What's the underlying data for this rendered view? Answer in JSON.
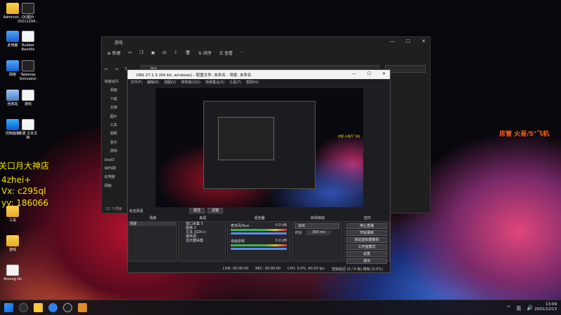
{
  "desktop": {
    "icons": [
      {
        "label": "Administ...",
        "kind": "folder"
      },
      {
        "label": "QQ图片\n20211204...",
        "kind": "dark"
      },
      {
        "label": "此电脑",
        "kind": "pc"
      },
      {
        "label": "Rubber\nBandits",
        "kind": "doc"
      },
      {
        "label": "网络",
        "kind": "pc"
      },
      {
        "label": "Tabletop\nSimulator",
        "kind": "dark"
      },
      {
        "label": "回收站",
        "kind": "bin"
      },
      {
        "label": "游戏",
        "kind": "doc"
      },
      {
        "label": "控制面板",
        "kind": "app"
      },
      {
        "label": "新建 文本文\n档",
        "kind": "doc"
      },
      {
        "label": "工具",
        "kind": "folder"
      },
      {
        "label": "游戏",
        "kind": "folder"
      },
      {
        "label": "Among Us",
        "kind": "doc"
      }
    ]
  },
  "overlay": {
    "line1": "关口月大神店",
    "line2": "4zhei+",
    "line3": "Vx: c295ql",
    "line4": "yy: 186066"
  },
  "right_overlay": "房管 火哥/5°飞机",
  "preview_text": "房管 火哥/5°飞机",
  "explorer": {
    "title": "游戏",
    "new_label": "新建",
    "sort_label": "排序",
    "view_label": "查看",
    "more_label": "···",
    "address": "游戏",
    "nav": [
      "快速访问",
      "桌面",
      "下载",
      "文档",
      "图片",
      "工具",
      "视频",
      "音乐",
      "游戏",
      "OneD",
      "WPS网",
      "此电脑",
      "网络"
    ],
    "status": "17 个项目"
  },
  "obs": {
    "title": "OBS 27.1.3 (64-bit, windows) - 配置文件: 未命名 - 场景: 未命名",
    "menu": [
      "文件(F)",
      "编辑(E)",
      "视图(V)",
      "停靠窗口(D)",
      "场景集合(S)",
      "工具(T)",
      "帮助(H)"
    ],
    "no_source": "未选择源",
    "props_label": "属性",
    "filter_label": "滤镜",
    "panels": {
      "scenes": "场景",
      "sources": "来源",
      "mixer": "混音器",
      "transitions": "转场特效",
      "controls": "控件"
    },
    "scene_list": [
      "场景"
    ],
    "source_list": [
      "窗口采集 5",
      "图像 2",
      "文本 (GDI+)",
      "媒体源",
      "显示器采集"
    ],
    "mixer_tracks": [
      {
        "name": "麦克风/Aux",
        "level": "0.0 dB"
      },
      {
        "name": "桌面音频",
        "level": "0.0 dB"
      }
    ],
    "transition": {
      "type": "淡出",
      "duration_label": "时长",
      "duration": "300 ms"
    },
    "controls": [
      "停止直播",
      "开始录制",
      "启动虚拟摄像机",
      "工作室模式",
      "设置",
      "退出"
    ],
    "statusbar": {
      "live": "LIVE: 00:00:00",
      "rec": "REC: 00:00:00",
      "cpu": "CPU: 0.0%, 60.00 fps",
      "frames": "渲染延迟 (0 / 0 帧) 跳帧 (0.0%)"
    }
  },
  "taskbar": {
    "tray": [
      "^",
      "英",
      "🔊"
    ],
    "time": "13:09",
    "date": "2021/12/13"
  }
}
